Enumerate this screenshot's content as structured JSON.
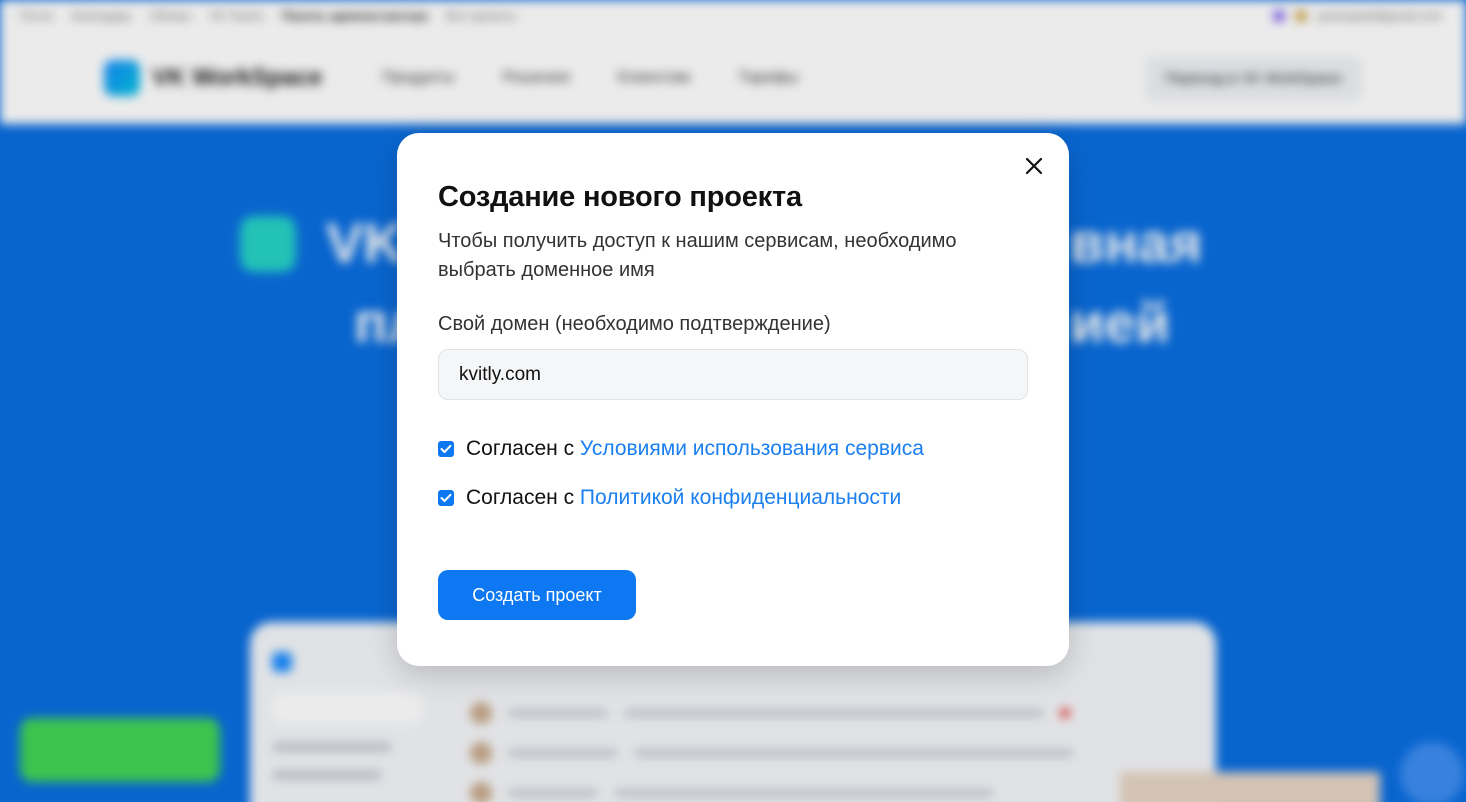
{
  "background": {
    "topbar_links": [
      "Почта",
      "Календарь",
      "Облако",
      "VK Teams",
      "Панель администратора",
      "Все проекты"
    ],
    "topbar_email": "yasenpatel@gmail.com",
    "brand": "VK WorkSpace",
    "nav_items": [
      "Продукты",
      "Решения",
      "Клиентам",
      "Тарифы"
    ],
    "header_button": "Переход в VK WorkSpace"
  },
  "modal": {
    "title": "Создание нового проекта",
    "subtitle": "Чтобы получить доступ к нашим сервисам, необходимо выбрать доменное имя",
    "domain_label": "Свой домен (необходимо подтверждение)",
    "domain_value": "kvitly.com",
    "terms_prefix": "Согласен с ",
    "terms_link": "Условиями использования сервиса",
    "terms_checked": true,
    "privacy_prefix": "Согласен с ",
    "privacy_link": "Политикой конфиденциальности",
    "privacy_checked": true,
    "submit_label": "Создать проект"
  },
  "colors": {
    "accent": "#0d78f2",
    "link": "#1a7ff0",
    "background_blue": "#0a6ee0"
  },
  "icons": {
    "close": "close-icon",
    "check": "checkmark-icon"
  }
}
